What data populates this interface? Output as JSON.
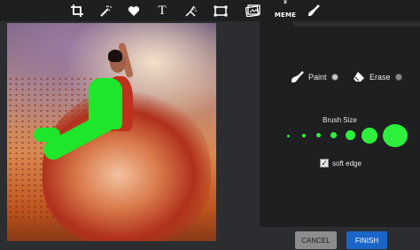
{
  "toolbar": {
    "tools": [
      {
        "name": "crop-icon"
      },
      {
        "name": "magic-wand-icon"
      },
      {
        "name": "heart-icon"
      },
      {
        "name": "text-icon",
        "glyph": "T"
      },
      {
        "name": "dust-icon"
      },
      {
        "name": "frame-icon"
      },
      {
        "name": "photo-icon"
      },
      {
        "name": "meme-icon",
        "label": "MEME"
      },
      {
        "name": "brush-icon"
      }
    ]
  },
  "panel": {
    "paint_label": "Paint",
    "erase_label": "Erase",
    "brush_size_label": "Brush Size",
    "brush_sizes_count": 7,
    "selected_brush": 6,
    "soft_edge_label": "soft edge",
    "soft_edge_checked": true
  },
  "buttons": {
    "cancel": "CANCEL",
    "finish": "FINISH"
  },
  "colors": {
    "mask": "#1ee62a",
    "accent": "#1a66c8",
    "panel_bg": "#1e1f21",
    "app_bg": "#2b2d30"
  }
}
